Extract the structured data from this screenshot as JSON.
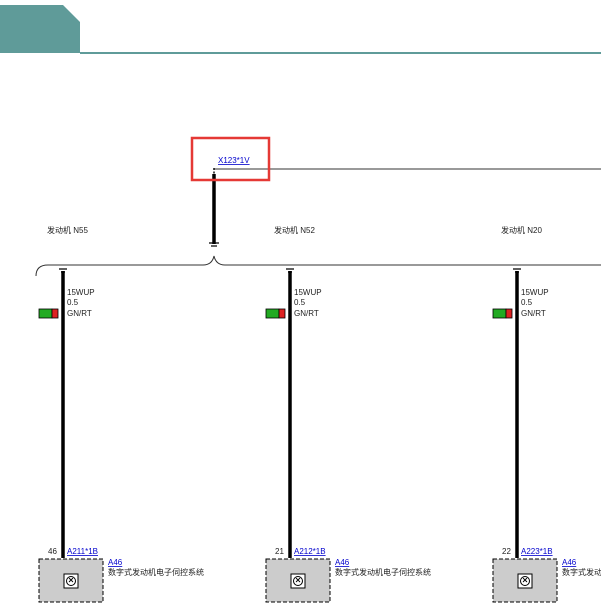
{
  "header": {
    "tab_color": "#5f9b99",
    "rule_color": "#5f9b99"
  },
  "connector_top": {
    "label": "X123*1V",
    "highlight_color": "#e53935"
  },
  "engines": [
    {
      "variant": "发动机 N55",
      "wire": {
        "code": "15WUP",
        "size": "0.5",
        "color": "GN/RT"
      },
      "pin": "46",
      "connector": "A211*1B",
      "module": "A46",
      "module_desc": "数字式发动机电子伺控系统"
    },
    {
      "variant": "发动机 N52",
      "wire": {
        "code": "15WUP",
        "size": "0.5",
        "color": "GN/RT"
      },
      "pin": "21",
      "connector": "A212*1B",
      "module": "A46",
      "module_desc": "数字式发动机电子伺控系统"
    },
    {
      "variant": "发动机 N20",
      "wire": {
        "code": "15WUP",
        "size": "0.5",
        "color": "GN/RT"
      },
      "pin": "22",
      "connector": "A223*1B",
      "module": "A46",
      "module_desc": "数字式发动机电子伺控系统"
    }
  ],
  "colors": {
    "wire_green": "#22aa22",
    "wire_red": "#dd2222",
    "module_fill": "#cccccc"
  }
}
